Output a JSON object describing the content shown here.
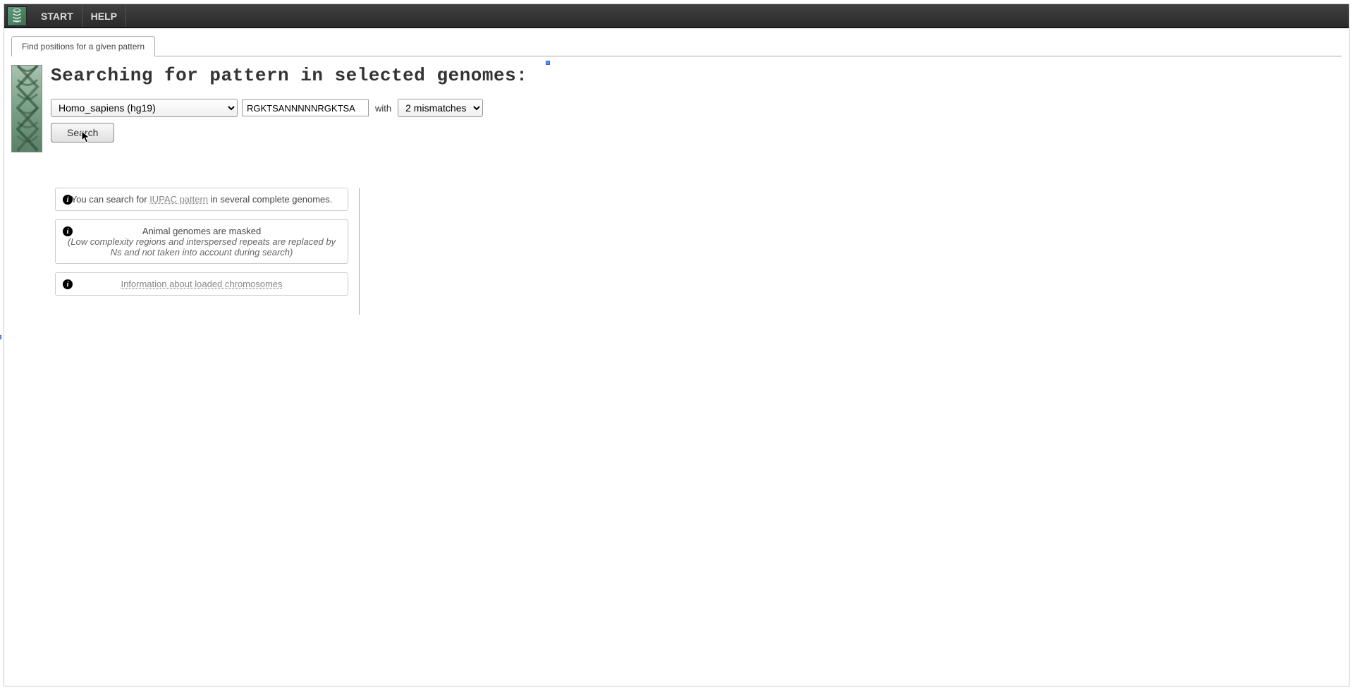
{
  "nav": {
    "start": "START",
    "help": "HELP"
  },
  "tab": {
    "label": "Find positions for a given pattern"
  },
  "heading": "Searching for pattern in selected genomes:",
  "form": {
    "genome_selected": "Homo_sapiens (hg19)",
    "pattern_value": "RGKTSANNNNNRGKTSA",
    "with_label": "with",
    "mismatch_selected": "2 mismatches",
    "search_label": "Search"
  },
  "info": {
    "box1_pre": "You can search for ",
    "box1_link": "IUPAC pattern",
    "box1_post": " in several complete genomes.",
    "box2_title": "Animal genomes are masked",
    "box2_detail": "(Low complexity regions and interspersed repeats are replaced by Ns and not taken into account during search)",
    "box3_link": "Information about loaded chromosomes"
  }
}
